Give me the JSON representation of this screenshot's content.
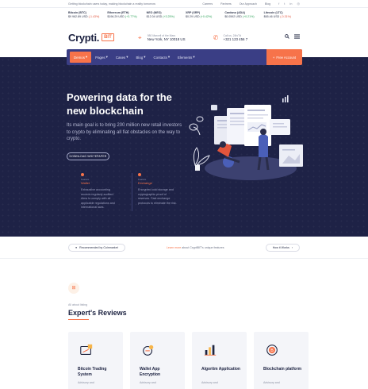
{
  "topbar": {
    "note": "Getting blockchain users today, making blockchain a reality tomorrow",
    "links": [
      "Careers",
      "Partners",
      "Our Approach",
      "Blog"
    ],
    "social": [
      "f",
      "t",
      "in",
      "◎"
    ]
  },
  "ticker": [
    {
      "name": "Bitcoin (BTC)",
      "price": "$9 962.89 USD",
      "change": "(-1.43%)",
      "down": true
    },
    {
      "name": "Ethereum (ETH)",
      "price": "$196.29 USD",
      "change": "(+3.77%)",
      "down": false
    },
    {
      "name": "NEO (NEO)",
      "price": "$12.04 USD",
      "change": "(+3.25%)",
      "down": false
    },
    {
      "name": "XRP (XRP)",
      "price": "$0.29 USD",
      "change": "(+0.42%)",
      "down": false
    },
    {
      "name": "Cardano (ADA)",
      "price": "$0.0592 USD",
      "change": "(+0.21%)",
      "down": false
    },
    {
      "name": "Litecoin (LTC)",
      "price": "$65.46 USD",
      "change": "(-0.31%)",
      "down": true
    }
  ],
  "header": {
    "logo": "Crypti.",
    "logo_badge": "BIT",
    "address_label": "980 Marcell of the Mars",
    "address_value": "New York, NY 10018 US",
    "phone_label": "Call us, 24h/7d",
    "phone_value": "+321 123 456 7"
  },
  "nav": {
    "items": [
      "Demos",
      "Pages",
      "Cases",
      "Blog",
      "Contacts",
      "Elements"
    ],
    "active_index": 0,
    "cta": "Free Account"
  },
  "hero": {
    "title": "Powering data for the new blockchain",
    "lead": "Its main goal is to bring 200 million new retail investors to crypto by eliminating all fiat obstacles on the way to crypto.",
    "button": "DOWNLOAD WHITEPAPER",
    "features": [
      {
        "small": "Feature",
        "title": "Wallet",
        "desc": "Exhaustive accounting records regularly audited. Aims to comply with all applicable regulations and international laws."
      },
      {
        "small": "Feature",
        "title": "Exchange",
        "desc": "Encrypted cold storage and cryptographic proof of reserves. Fast exchange protocols to eliminate the risk."
      }
    ]
  },
  "strip": {
    "left": "Recommended by Coinmarket",
    "mid_highlight": "Learn more",
    "mid_rest": "about CryptiBIT's unique features",
    "right": "How it Works"
  },
  "reviews": {
    "subtitle": "All about listing",
    "title": "Expert's Reviews",
    "cards": [
      {
        "name": "Bitcoin Trading System",
        "desc": "Advisory and"
      },
      {
        "name": "Wallet App Encryption",
        "desc": "Advisory and"
      },
      {
        "name": "Algoritm Application",
        "desc": "Advisory and"
      },
      {
        "name": "Blockchain platform",
        "desc": "Advisory and"
      }
    ]
  },
  "colors": {
    "accent": "#f7734a",
    "nav": "#3a3e85",
    "hero": "#1e2246"
  }
}
